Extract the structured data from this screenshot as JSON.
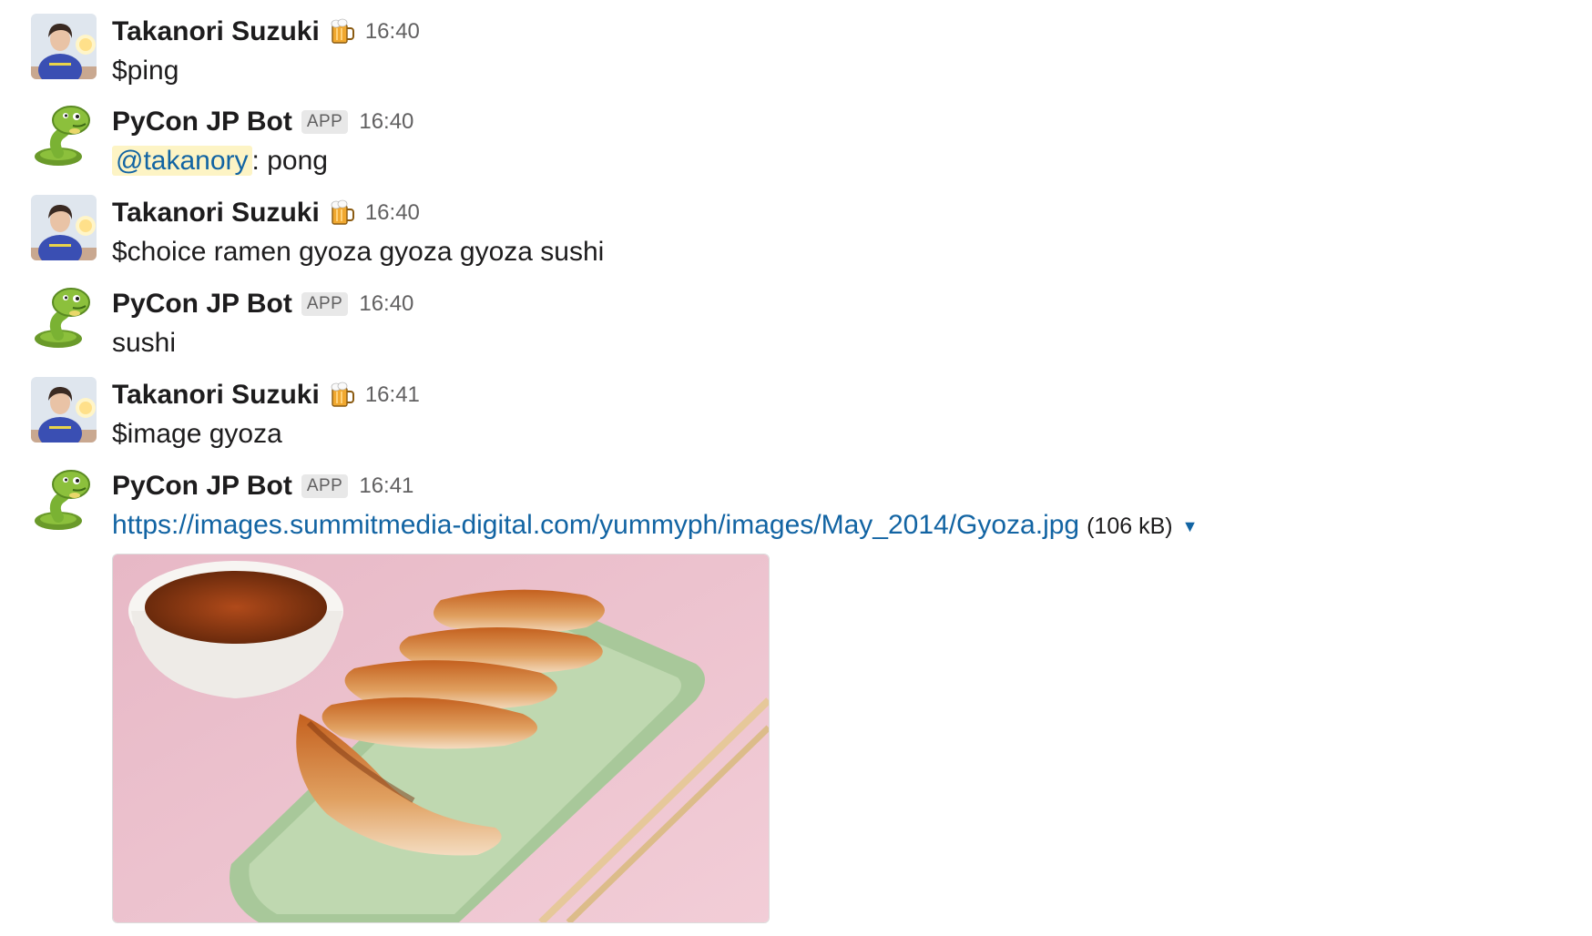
{
  "messages": [
    {
      "sender": "Takanori Suzuki",
      "status_icon": "beer-mug-icon",
      "time": "16:40",
      "text": "$ping"
    },
    {
      "sender": "PyCon JP Bot",
      "badge": "APP",
      "time": "16:40",
      "mention": "@takanory",
      "text": ": pong"
    },
    {
      "sender": "Takanori Suzuki",
      "status_icon": "beer-mug-icon",
      "time": "16:40",
      "text": "$choice ramen gyoza gyoza gyoza sushi"
    },
    {
      "sender": "PyCon JP Bot",
      "badge": "APP",
      "time": "16:40",
      "text": "sushi"
    },
    {
      "sender": "Takanori Suzuki",
      "status_icon": "beer-mug-icon",
      "time": "16:41",
      "text": "$image gyoza"
    },
    {
      "sender": "PyCon JP Bot",
      "badge": "APP",
      "time": "16:41",
      "link": "https://images.summitmedia-digital.com/yummyph/images/May_2014/Gyoza.jpg",
      "file_size": "(106 kB)",
      "expand_icon": "caret-down-icon",
      "preview": "gyoza-photo"
    }
  ],
  "colors": {
    "link": "#1264a3",
    "mention_bg": "#fdf4c5",
    "badge_bg": "#e8e8e8",
    "muted": "#616061"
  }
}
